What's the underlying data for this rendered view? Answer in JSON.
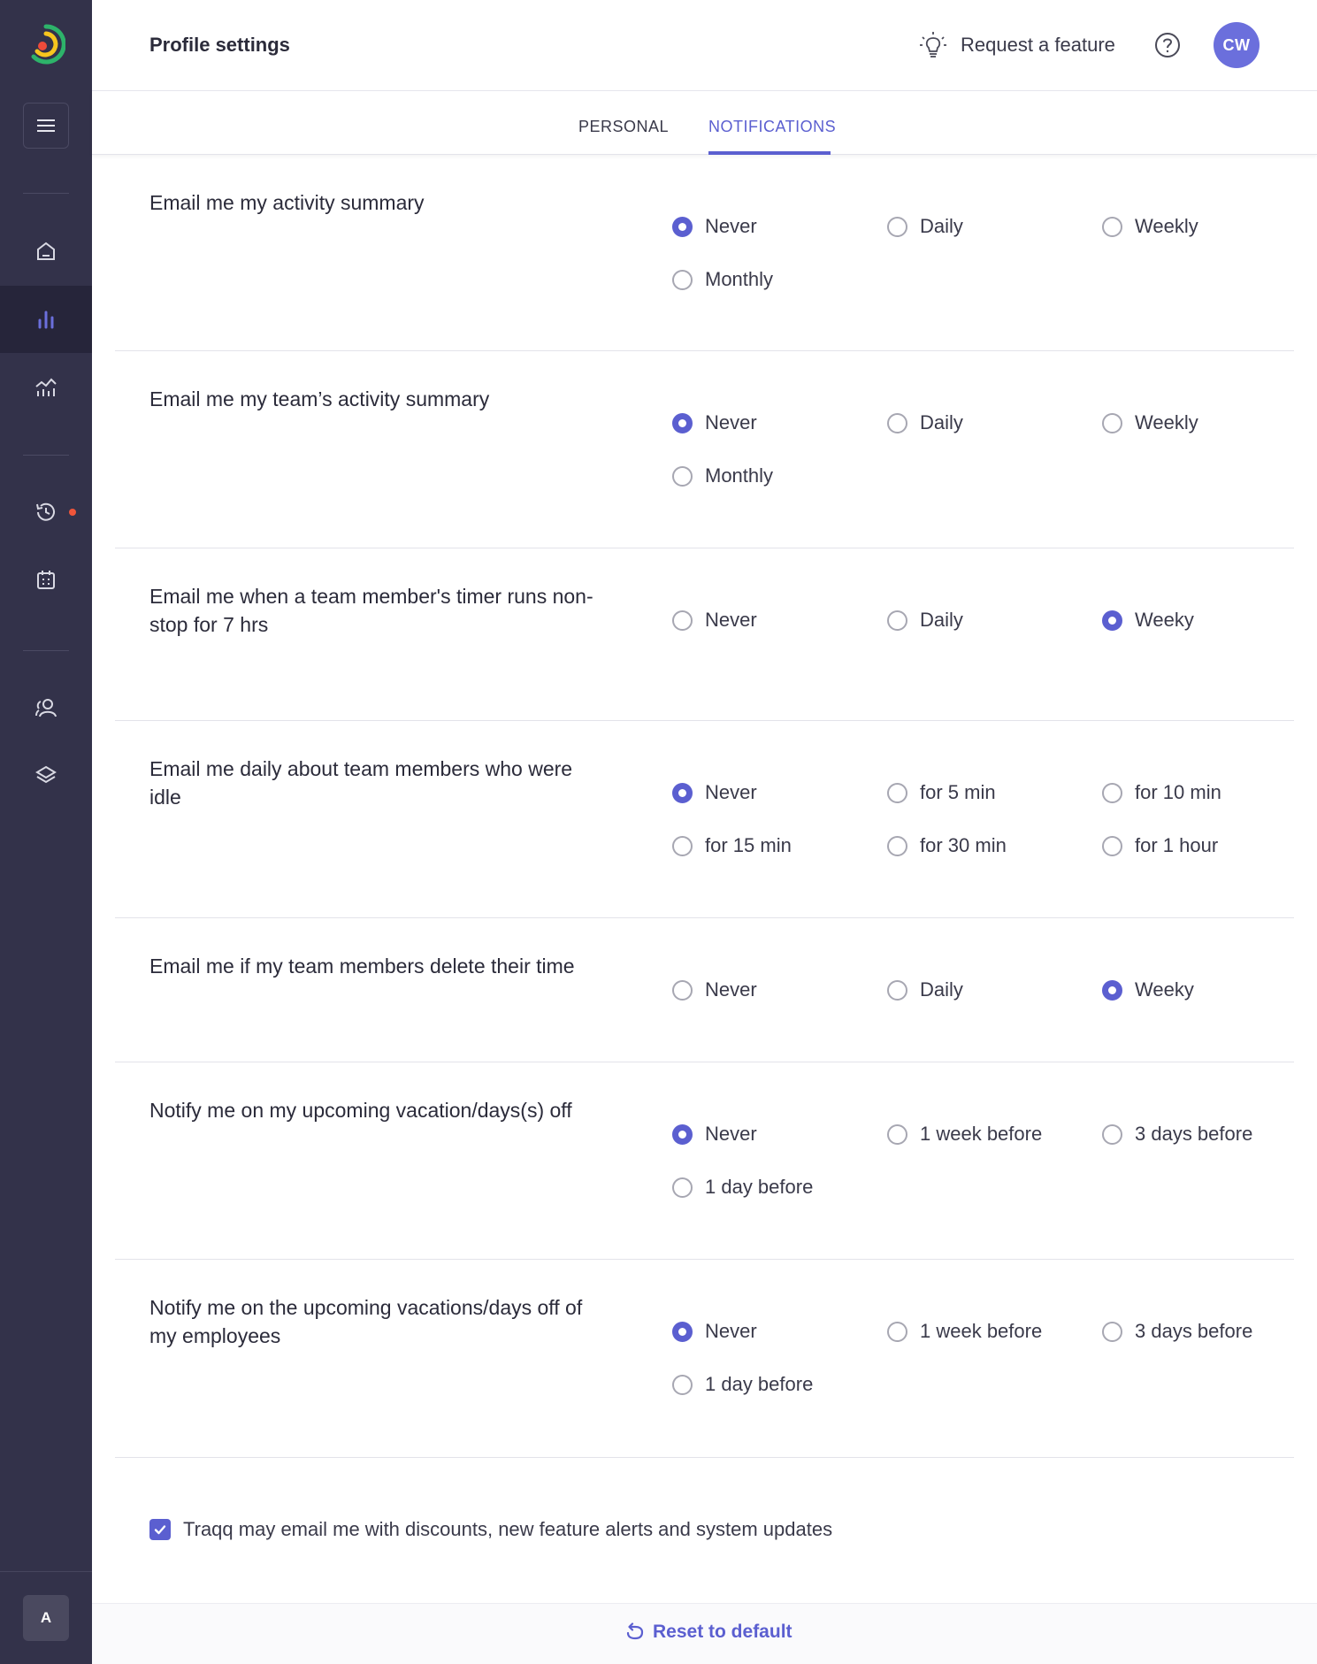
{
  "header": {
    "title": "Profile settings",
    "request_feature": "Request a feature",
    "avatar_initials": "CW"
  },
  "tabs": [
    {
      "label": "PERSONAL",
      "active": false
    },
    {
      "label": "NOTIFICATIONS",
      "active": true
    }
  ],
  "sidebar": {
    "account_initial": "A",
    "items": [
      {
        "icon": "home-icon"
      },
      {
        "icon": "bar-chart-icon",
        "active": true
      },
      {
        "icon": "trend-chart-icon"
      },
      {
        "icon": "history-icon",
        "has_dot": true
      },
      {
        "icon": "calendar-icon"
      },
      {
        "icon": "team-icon"
      },
      {
        "icon": "layers-icon"
      }
    ]
  },
  "settings": [
    {
      "label": "Email me my activity summary",
      "options": [
        "Never",
        "Daily",
        "Weekly",
        "Monthly"
      ],
      "selected": "Never"
    },
    {
      "label": "Email me my team’s activity summary",
      "options": [
        "Never",
        "Daily",
        "Weekly",
        "Monthly"
      ],
      "selected": "Never"
    },
    {
      "label": "Email me when a team member's timer runs non-stop for 7 hrs",
      "options": [
        "Never",
        "Daily",
        "Weeky"
      ],
      "selected": "Weeky"
    },
    {
      "label": "Email me daily about team members who were idle",
      "options": [
        "Never",
        "for 5 min",
        "for 10 min",
        "for 15 min",
        "for 30 min",
        "for 1 hour"
      ],
      "selected": "Never"
    },
    {
      "label": "Email me if my team members delete their time",
      "options": [
        "Never",
        "Daily",
        "Weeky"
      ],
      "selected": "Weeky"
    },
    {
      "label": "Notify me on my upcoming vacation/days(s) off",
      "options": [
        "Never",
        "1 week before",
        "3 days before",
        "1 day before"
      ],
      "selected": "Never"
    },
    {
      "label": "Notify me on the upcoming vacations/days off of my employees",
      "options": [
        "Never",
        "1 week before",
        "3 days before",
        "1 day before"
      ],
      "selected": "Never"
    }
  ],
  "marketing_consent": {
    "label": "Traqq may email me with discounts, new feature alerts and system updates",
    "checked": true
  },
  "footer": {
    "reset_label": "Reset to default"
  },
  "colors": {
    "accent": "#5b5fd0",
    "sidebar_bg": "#33324a",
    "avatar_bg": "#6b6fdc",
    "notification_dot": "#f0553a"
  }
}
